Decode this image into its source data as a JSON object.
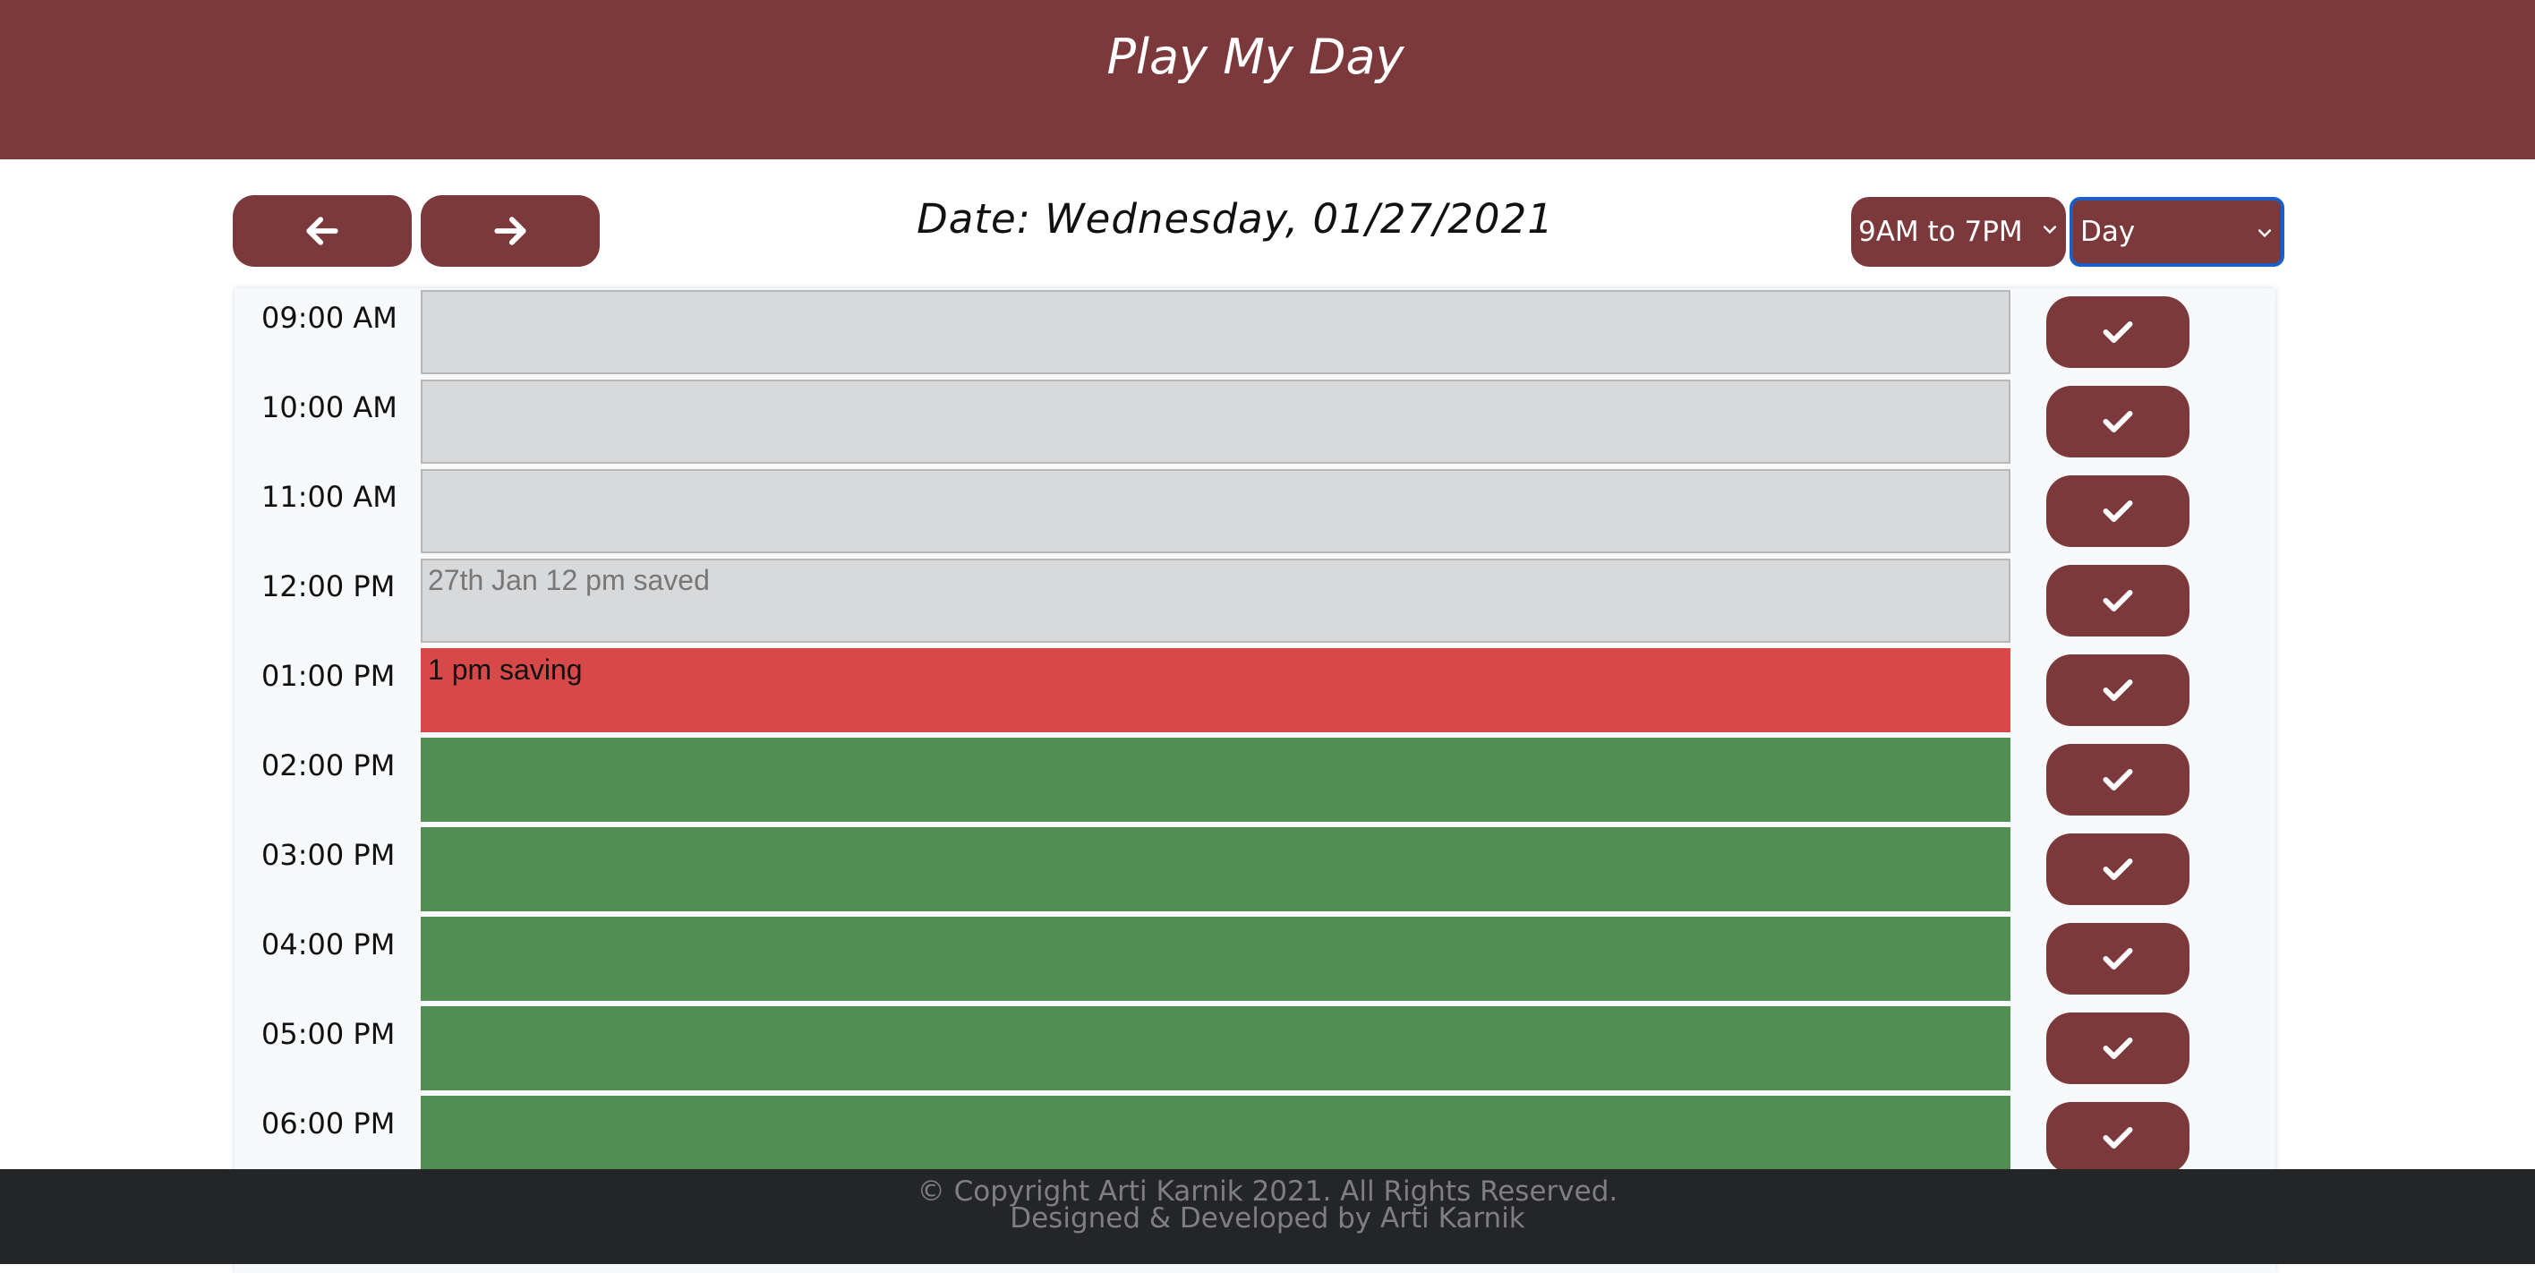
{
  "header": {
    "title": "Play My Day"
  },
  "nav": {
    "prev_icon": "arrow-left-icon",
    "next_icon": "arrow-right-icon"
  },
  "date": {
    "label": "Date: Wednesday, 01/27/2021"
  },
  "controls": {
    "hours_range": {
      "selected": "9AM to 7PM"
    },
    "view_mode": {
      "selected": "Day"
    }
  },
  "schedule": [
    {
      "time": "09:00 AM",
      "text": "",
      "state": "past"
    },
    {
      "time": "10:00 AM",
      "text": "",
      "state": "past"
    },
    {
      "time": "11:00 AM",
      "text": "",
      "state": "past"
    },
    {
      "time": "12:00 PM",
      "text": "27th Jan 12 pm saved",
      "state": "past"
    },
    {
      "time": "01:00 PM",
      "text": "1 pm saving",
      "state": "present"
    },
    {
      "time": "02:00 PM",
      "text": "",
      "state": "future"
    },
    {
      "time": "03:00 PM",
      "text": "",
      "state": "future"
    },
    {
      "time": "04:00 PM",
      "text": "",
      "state": "future"
    },
    {
      "time": "05:00 PM",
      "text": "",
      "state": "future"
    },
    {
      "time": "06:00 PM",
      "text": "",
      "state": "future"
    }
  ],
  "colors": {
    "brand": "#7b393b",
    "past": "#d8d9db",
    "present": "#d74848",
    "future": "#508e51",
    "footer": "#242526"
  },
  "footer": {
    "copyright": "© Copyright Arti Karnik 2021. All Rights Reserved.",
    "credit": "Designed & Developed by Arti Karnik"
  }
}
